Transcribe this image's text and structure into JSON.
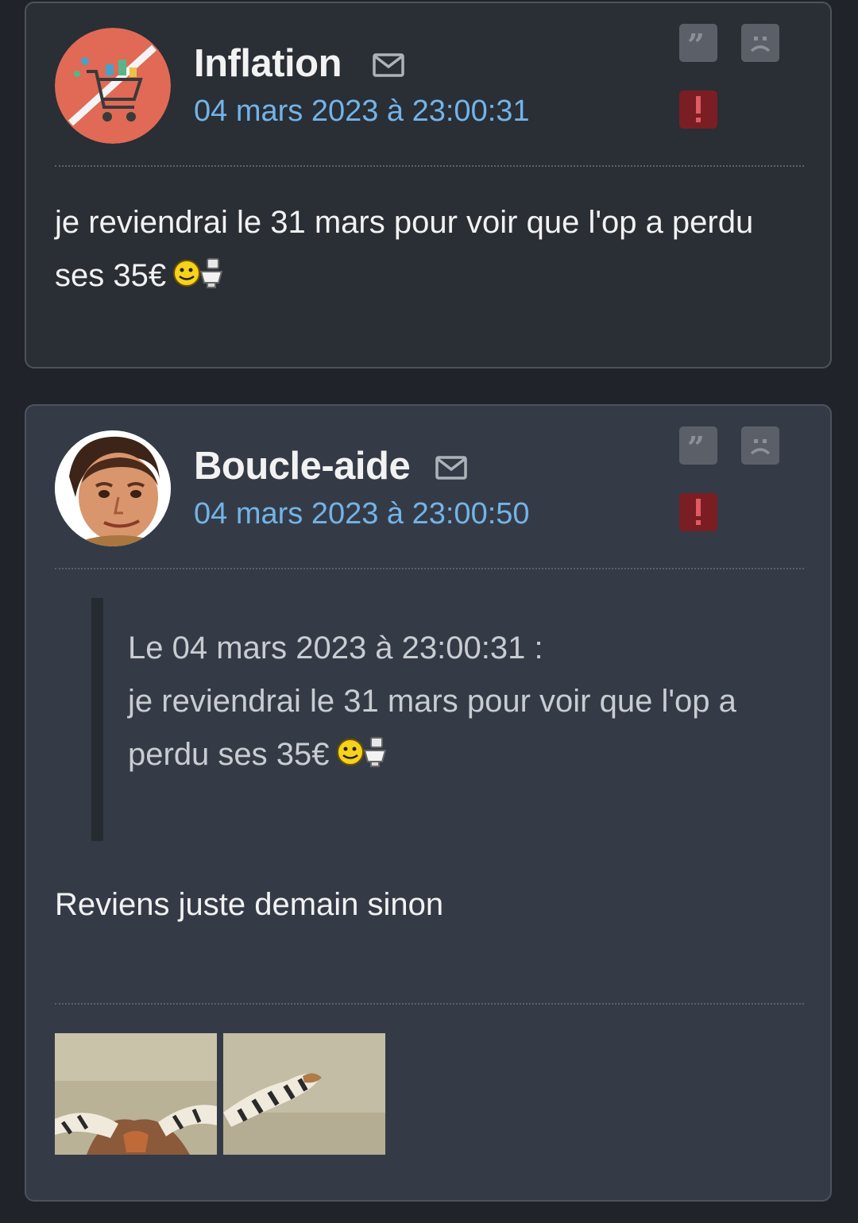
{
  "posts": [
    {
      "author": "Inflation",
      "date": "04 mars 2023 à 23:00:31",
      "message": "je reviendrai le 31 mars pour voir que l'op a perdu ses 35€"
    },
    {
      "author": "Boucle-aide",
      "date": "04 mars 2023 à 23:00:50",
      "quote": {
        "header": "Le 04 mars 2023 à 23:00:31 :",
        "text": "je reviendrai le 31 mars pour voir que l'op a perdu ses 35€"
      },
      "message": "Reviens juste demain sinon"
    }
  ],
  "icons": {
    "quote": "quote-icon",
    "private_message": "sad-face-icon",
    "report": "exclamation-icon",
    "mail": "mail-icon",
    "smiley": "smiley-wc-icon"
  },
  "colors": {
    "page_bg": "#202329",
    "post1_bg": "#2a2e35",
    "post2_bg": "#353b46",
    "date": "#72b4e8",
    "report": "#7a1e24"
  }
}
